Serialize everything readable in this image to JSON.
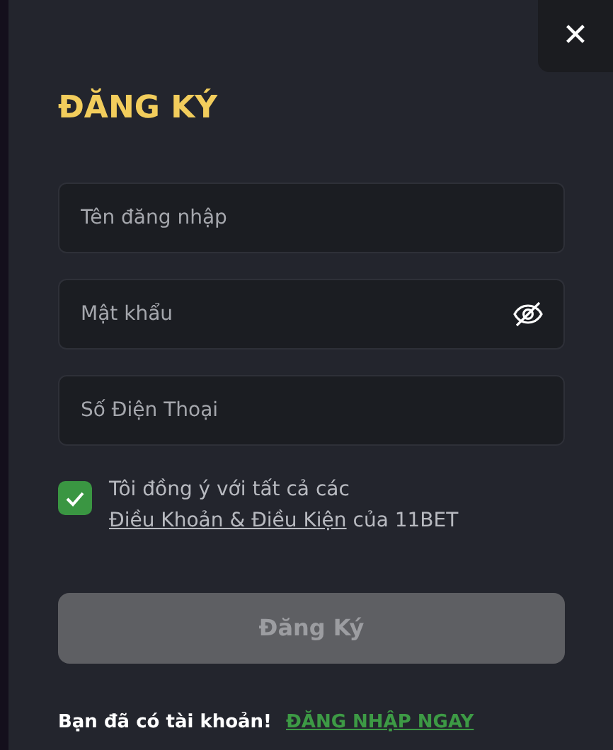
{
  "dialog": {
    "title": "ĐĂNG KÝ",
    "close": "✕"
  },
  "fields": [
    {
      "kind": "text",
      "placeholder": "Tên đăng nhập"
    },
    {
      "kind": "password",
      "placeholder": "Mật khẩu"
    },
    {
      "kind": "text",
      "placeholder": "Số Điện Thoại"
    }
  ],
  "terms": {
    "checked": true,
    "before": "Tôi đồng ý với tất cả các",
    "link": "Điều Khoản & Điều Kiện",
    "after": "của 11BET"
  },
  "submit": {
    "label": "Đăng Ký",
    "disabled": true
  },
  "footer": {
    "text": "Bạn đã có tài khoản!",
    "link": "ĐĂNG NHẬP NGAY"
  }
}
